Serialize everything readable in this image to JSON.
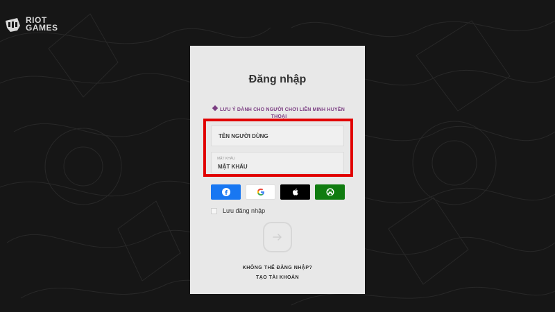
{
  "brand": {
    "logo_line1": "RIOT",
    "logo_line2": "GAMES"
  },
  "login": {
    "title": "Đăng nhập",
    "notice": "LƯU Ý DÀNH CHO NGƯỜI CHƠI LIÊN MINH HUYỀN THOẠI",
    "username_placeholder": "TÊN NGƯỜI DÙNG",
    "password_label": "MẬT KHẨU",
    "password_value": "MẬT KHẨU",
    "remember_label": "Lưu đăng nhập",
    "cant_sign_in": "KHÔNG THỂ ĐĂNG NHẬP?",
    "create_account": "TẠO TÀI KHOẢN"
  },
  "social_buttons": {
    "facebook_icon": "f",
    "google_icon": "G",
    "apple_icon": "apple-logo",
    "xbox_icon": "xbox-logo"
  },
  "colors": {
    "background": "#161616",
    "panel": "#e8e8e8",
    "highlight": "#e10000",
    "notice": "#7b3d82",
    "facebook": "#1877f2",
    "xbox": "#107c10"
  }
}
